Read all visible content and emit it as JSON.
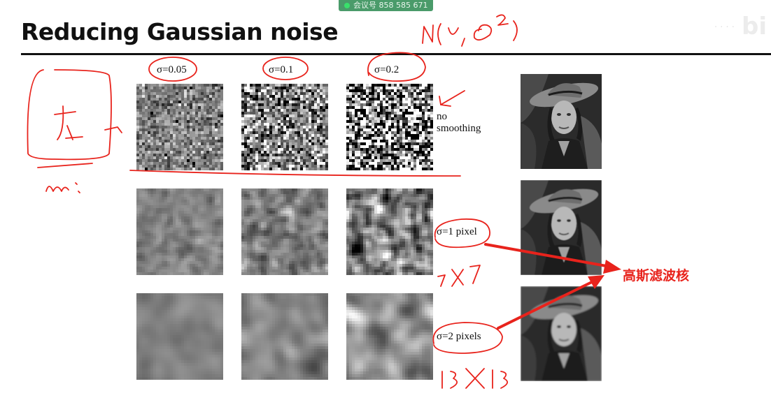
{
  "meeting_badge": "会议号 858 585 671",
  "slide": {
    "title": "Reducing Gaussian noise",
    "columns": [
      {
        "label": "σ=0.05",
        "noise": 0.05
      },
      {
        "label": "σ=0.1",
        "noise": 0.1
      },
      {
        "label": "σ=0.2",
        "noise": 0.2
      }
    ],
    "rows": [
      {
        "label": "no smoothing",
        "smoothing": 0
      },
      {
        "label": "σ=1 pixel",
        "smoothing": 1
      },
      {
        "label": "σ=2 pixels",
        "smoothing": 2
      }
    ],
    "caption": ""
  },
  "annotations": {
    "title_note": "N(U, σ²)",
    "kernel_label": "高斯滤波核",
    "size_note_1": "7X7",
    "size_note_2": "13X13",
    "margin_note_top": "左",
    "margin_note_bottom": "m:"
  },
  "colors": {
    "annotation": "#e8231c",
    "title": "#111111",
    "badge": "#4a9b6a"
  }
}
